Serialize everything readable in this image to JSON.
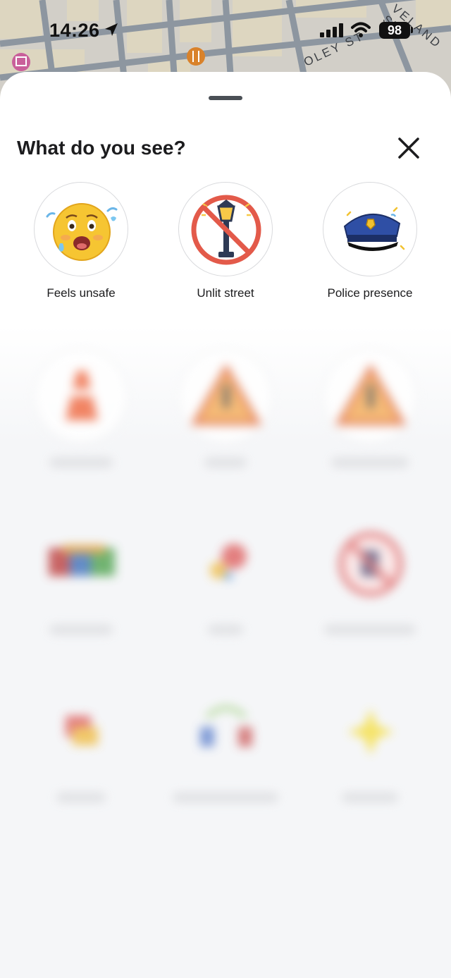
{
  "status_bar": {
    "time": "14:26",
    "battery": "98"
  },
  "map": {
    "street_1": "OLEY ST",
    "street_2": "VELAND ST"
  },
  "sheet": {
    "title": "What do you see?"
  },
  "options": [
    {
      "label": "Feels unsafe",
      "icon": "scared-face-icon"
    },
    {
      "label": "Unlit street",
      "icon": "no-streetlight-icon"
    },
    {
      "label": "Police presence",
      "icon": "police-cap-icon"
    }
  ],
  "blurred_options": [
    {
      "icon": "traffic-cone-icon"
    },
    {
      "icon": "warning-sign-icon"
    },
    {
      "icon": "warning-sign-icon"
    },
    {
      "icon": "flag-icon"
    },
    {
      "icon": "party-icon"
    },
    {
      "icon": "prohibited-icon"
    },
    {
      "icon": "car-icon"
    },
    {
      "icon": "crowd-icon"
    },
    {
      "icon": "sparkle-icon"
    }
  ],
  "colors": {
    "accent_text": "#1c1c1e",
    "background": "#f6f7f9",
    "sheet": "#ffffff"
  }
}
